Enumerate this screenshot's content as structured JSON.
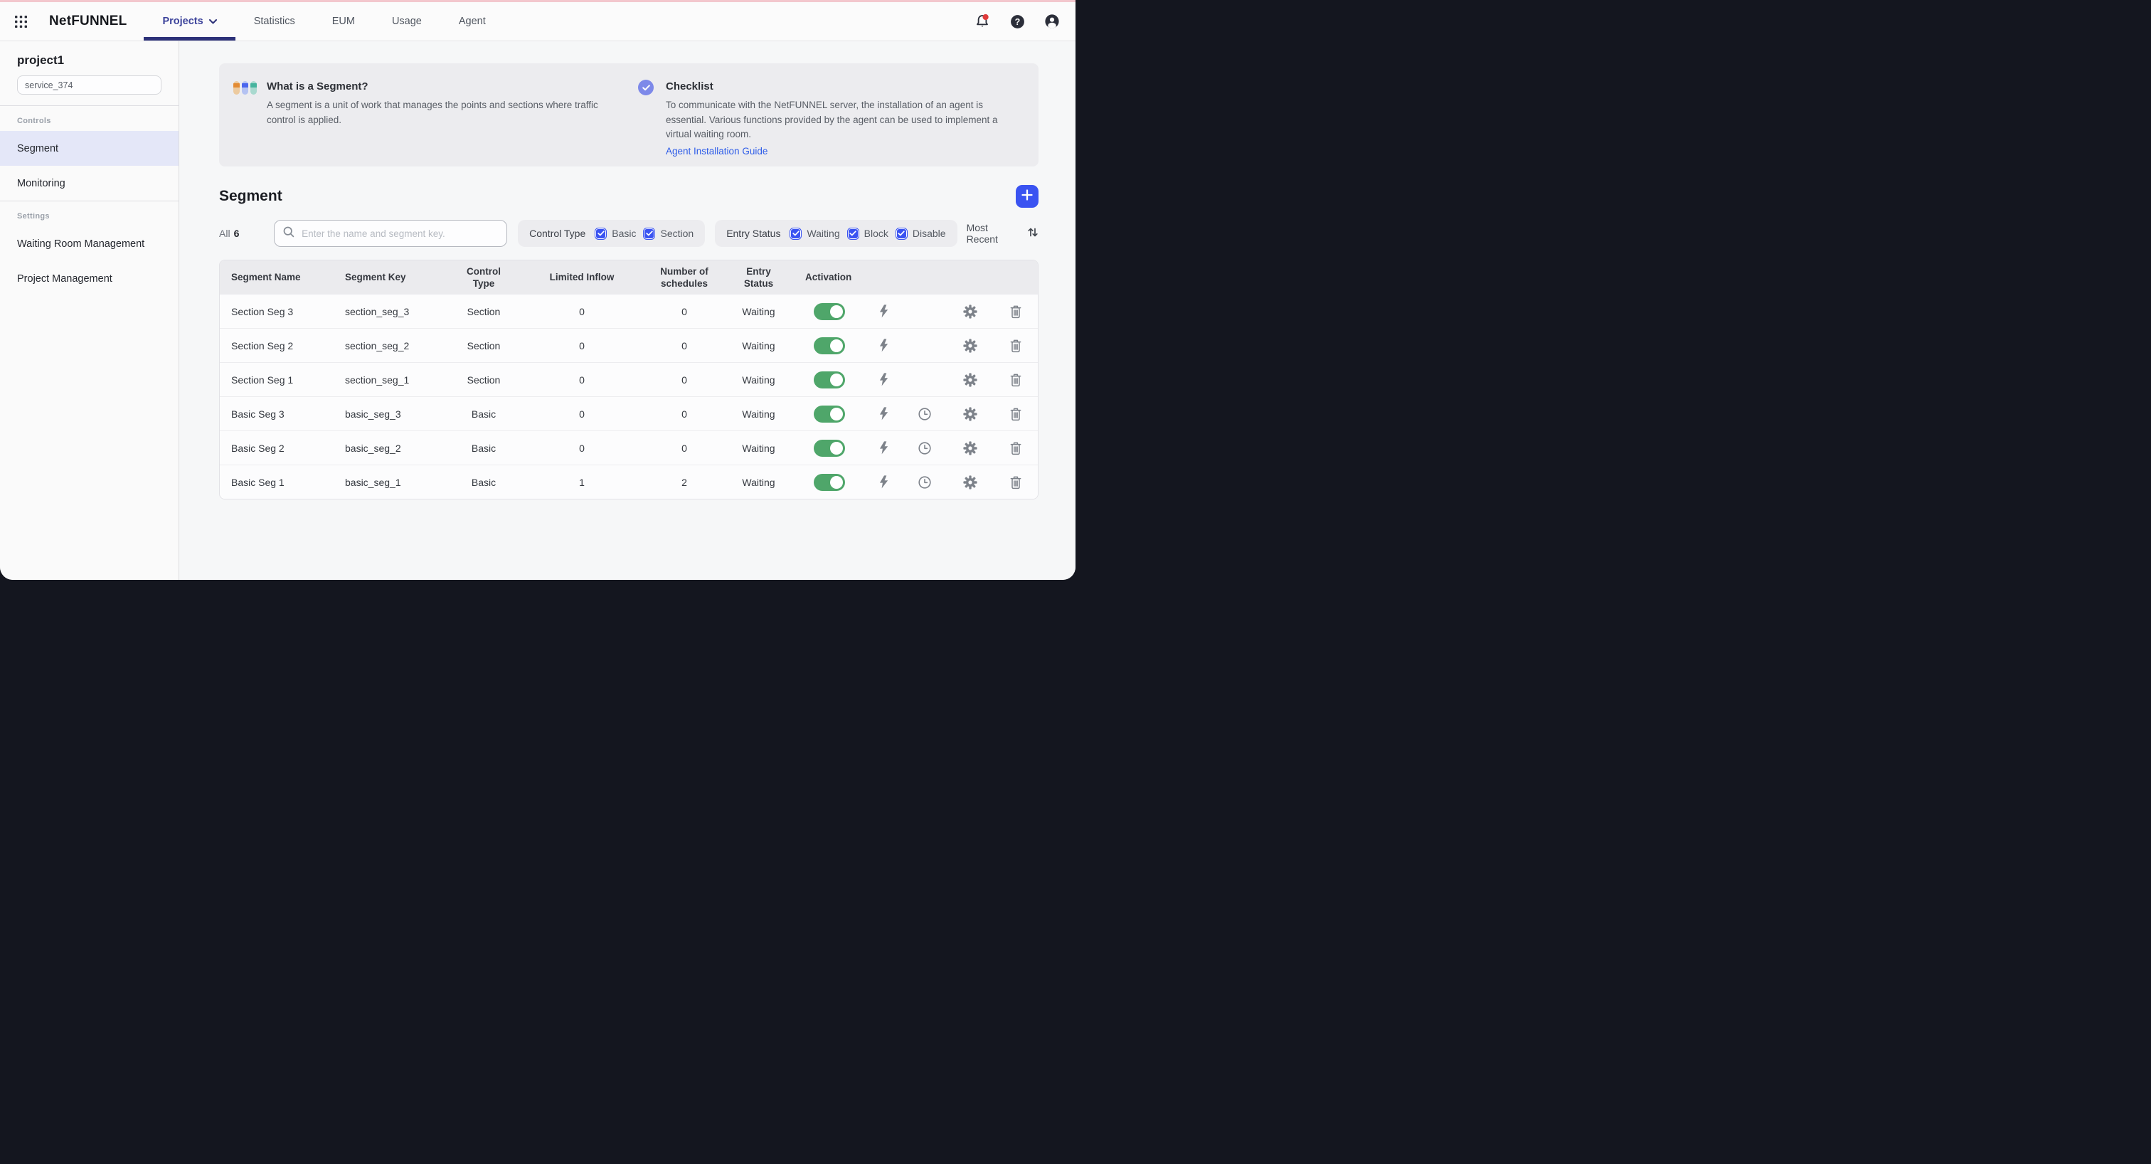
{
  "colors": {
    "accent-blue": "#3a53f1",
    "nav-active": "#3c439b",
    "nav-underline": "#2c3178",
    "toggle-green": "#4fa66a",
    "link-blue": "#2d5ce8",
    "badge-red": "#df3b3b",
    "top-strip-pink": "#f3c7cd",
    "check-circle": "#7d89e9",
    "icon-gray": "#7d828a",
    "window-backdrop": "#14161f"
  },
  "topbar": {
    "logo": "NetFUNNEL",
    "nav": [
      {
        "label": "Projects",
        "active": true
      },
      {
        "label": "Statistics",
        "active": false
      },
      {
        "label": "EUM",
        "active": false
      },
      {
        "label": "Usage",
        "active": false
      },
      {
        "label": "Agent",
        "active": false
      }
    ]
  },
  "sidebar": {
    "project_name": "project1",
    "service_name": "service_374",
    "groups": [
      {
        "label": "Controls",
        "items": [
          "Segment",
          "Monitoring"
        ],
        "active_item": "Segment"
      },
      {
        "label": "Settings",
        "items": [
          "Waiting Room Management",
          "Project Management"
        ],
        "active_item": ""
      }
    ]
  },
  "banner": {
    "left": {
      "title": "What is a Segment?",
      "body": "A segment is a unit of work that manages the points and sections where traffic control is applied."
    },
    "right": {
      "title": "Checklist",
      "body": "To communicate with the NetFUNNEL server, the installation of an agent is essential. Various functions provided by the agent can be used to implement a virtual waiting room.",
      "link_label": "Agent Installation Guide"
    }
  },
  "page": {
    "title": "Segment"
  },
  "toolbar": {
    "count_label": "All",
    "count": "6",
    "search": {
      "placeholder": "Enter the name and segment key."
    },
    "control_type": {
      "label": "Control Type",
      "options": [
        "Basic",
        "Section"
      ],
      "checked": [
        true,
        true
      ]
    },
    "entry_status": {
      "label": "Entry Status",
      "options": [
        "Waiting",
        "Block",
        "Disable"
      ],
      "checked": [
        true,
        true,
        true
      ]
    },
    "sort": {
      "label": "Most Recent"
    }
  },
  "table": {
    "columns": [
      "Segment Name",
      "Segment Key",
      "Control Type",
      "Limited Inflow",
      "Number of schedules",
      "Entry Status",
      "Activation"
    ],
    "rows": [
      {
        "name": "Section Seg 3",
        "key": "section_seg_3",
        "control_type": "Section",
        "limited_inflow": "0",
        "schedules": "0",
        "entry_status": "Waiting",
        "activation": true,
        "has_schedule": false
      },
      {
        "name": "Section Seg 2",
        "key": "section_seg_2",
        "control_type": "Section",
        "limited_inflow": "0",
        "schedules": "0",
        "entry_status": "Waiting",
        "activation": true,
        "has_schedule": false
      },
      {
        "name": "Section Seg 1",
        "key": "section_seg_1",
        "control_type": "Section",
        "limited_inflow": "0",
        "schedules": "0",
        "entry_status": "Waiting",
        "activation": true,
        "has_schedule": false
      },
      {
        "name": "Basic Seg 3",
        "key": "basic_seg_3",
        "control_type": "Basic",
        "limited_inflow": "0",
        "schedules": "0",
        "entry_status": "Waiting",
        "activation": true,
        "has_schedule": true
      },
      {
        "name": "Basic Seg 2",
        "key": "basic_seg_2",
        "control_type": "Basic",
        "limited_inflow": "0",
        "schedules": "0",
        "entry_status": "Waiting",
        "activation": true,
        "has_schedule": true
      },
      {
        "name": "Basic Seg 1",
        "key": "basic_seg_1",
        "control_type": "Basic",
        "limited_inflow": "1",
        "schedules": "2",
        "entry_status": "Waiting",
        "activation": true,
        "has_schedule": true
      }
    ]
  }
}
